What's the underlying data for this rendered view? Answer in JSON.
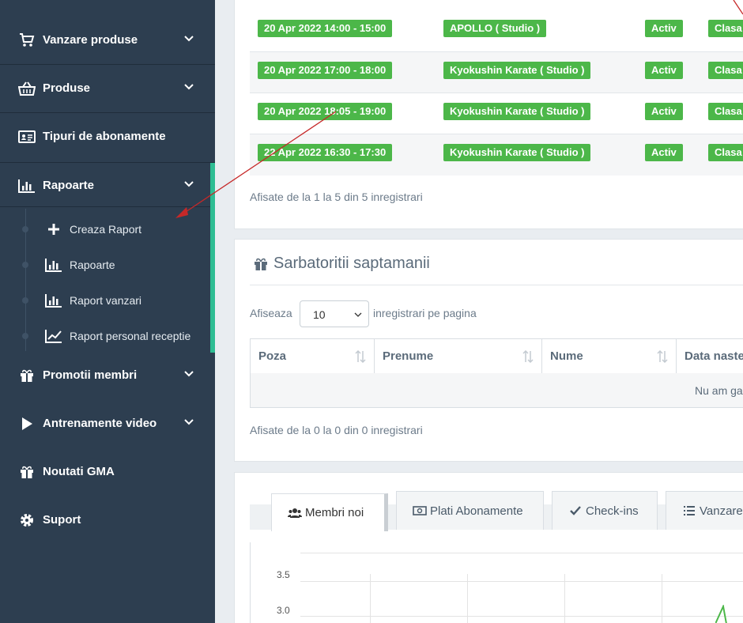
{
  "sidebar": {
    "items": [
      {
        "label": "Vanzare produse",
        "icon": "cart-icon"
      },
      {
        "label": "Produse",
        "icon": "basket-icon"
      },
      {
        "label": "Tipuri de abonamente",
        "icon": "id-card-icon"
      },
      {
        "label": "Rapoarte",
        "icon": "bar-chart-icon"
      },
      {
        "label": "Promotii membri",
        "icon": "gift-icon"
      },
      {
        "label": "Antrenamente video",
        "icon": "play-icon"
      },
      {
        "label": "Noutati GMA",
        "icon": "gift-icon"
      },
      {
        "label": "Suport",
        "icon": "gear-icon"
      }
    ],
    "rapoarte_sub": [
      {
        "label": "Creaza Raport",
        "icon": "plus-icon"
      },
      {
        "label": "Rapoarte",
        "icon": "bar-chart-icon"
      },
      {
        "label": "Raport vanzari",
        "icon": "bar-chart-icon"
      },
      {
        "label": "Raport personal receptie",
        "icon": "line-chart-icon"
      }
    ],
    "active_color": "#2ebd93"
  },
  "sessions": {
    "rows": [
      {
        "date": "20 Apr 2022 14:00 - 15:00",
        "class": "APOLLO ( Studio )",
        "status": "Activ",
        "type": "Clasa"
      },
      {
        "date": "20 Apr 2022 17:00 - 18:00",
        "class": "Kyokushin Karate ( Studio )",
        "status": "Activ",
        "type": "Clasa"
      },
      {
        "date": "20 Apr 2022 18:05 - 19:00",
        "class": "Kyokushin Karate ( Studio )",
        "status": "Activ",
        "type": "Clasa"
      },
      {
        "date": "22 Apr 2022 16:30 - 17:30",
        "class": "Kyokushin Karate ( Studio )",
        "status": "Activ",
        "type": "Clasa"
      }
    ],
    "info": "Afisate de la 1 la 5 din 5 inregistrari",
    "label_color": "#4cb749"
  },
  "birthdays": {
    "title": "Sarbatoritii saptamanii",
    "show_label": "Afiseaza",
    "page_size": "10",
    "per_page_label": "inregistrari pe pagina",
    "columns": [
      "Poza",
      "Prenume",
      "Nume",
      "Data naste"
    ],
    "empty": "Nu am ga",
    "info": "Afisate de la 0 la 0 din 0 inregistrari"
  },
  "stats": {
    "tabs": [
      {
        "label": "Membri noi",
        "icon": "users-icon"
      },
      {
        "label": "Plati Abonamente",
        "icon": "money-icon"
      },
      {
        "label": "Check-ins",
        "icon": "check-icon"
      },
      {
        "label": "Vanzare",
        "icon": "list-icon"
      }
    ],
    "y_ticks": [
      "3.5",
      "3.0"
    ]
  }
}
